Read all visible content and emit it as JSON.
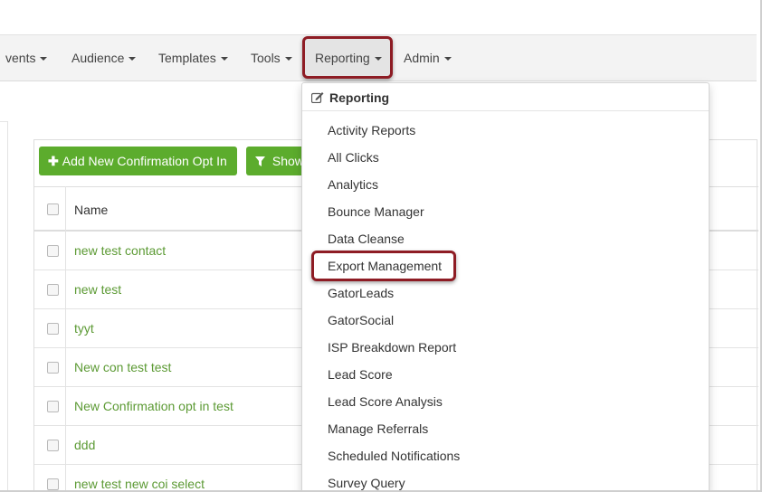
{
  "navbar": {
    "items": [
      {
        "label": "vents"
      },
      {
        "label": "Audience"
      },
      {
        "label": "Templates"
      },
      {
        "label": "Tools"
      },
      {
        "label": "Reporting"
      },
      {
        "label": "Admin"
      }
    ]
  },
  "toolbar": {
    "add_button_label": "Add New Confirmation Opt In",
    "add_button_icon": "plus-icon",
    "show_button_label": "Show",
    "show_button_icon": "filter-icon",
    "button_color": "#5cac2d"
  },
  "table": {
    "header_name": "Name",
    "rows": [
      {
        "name": "new test contact"
      },
      {
        "name": "new test"
      },
      {
        "name": "tyyt"
      },
      {
        "name": "New con test test"
      },
      {
        "name": "New Confirmation opt in test"
      },
      {
        "name": "ddd"
      },
      {
        "name": "new test new coi select"
      }
    ],
    "link_color": "#5c9a34"
  },
  "dropdown": {
    "header": "Reporting",
    "header_icon": "edit-icon",
    "items": [
      {
        "label": "Activity Reports"
      },
      {
        "label": "All Clicks"
      },
      {
        "label": "Analytics"
      },
      {
        "label": "Bounce Manager"
      },
      {
        "label": "Data Cleanse"
      },
      {
        "label": "Export Management"
      },
      {
        "label": "GatorLeads"
      },
      {
        "label": "GatorSocial"
      },
      {
        "label": "ISP Breakdown Report"
      },
      {
        "label": "Lead Score"
      },
      {
        "label": "Lead Score Analysis"
      },
      {
        "label": "Manage Referrals"
      },
      {
        "label": "Scheduled Notifications"
      },
      {
        "label": "Survey Query"
      }
    ],
    "highlight_color": "#8e1c24"
  }
}
